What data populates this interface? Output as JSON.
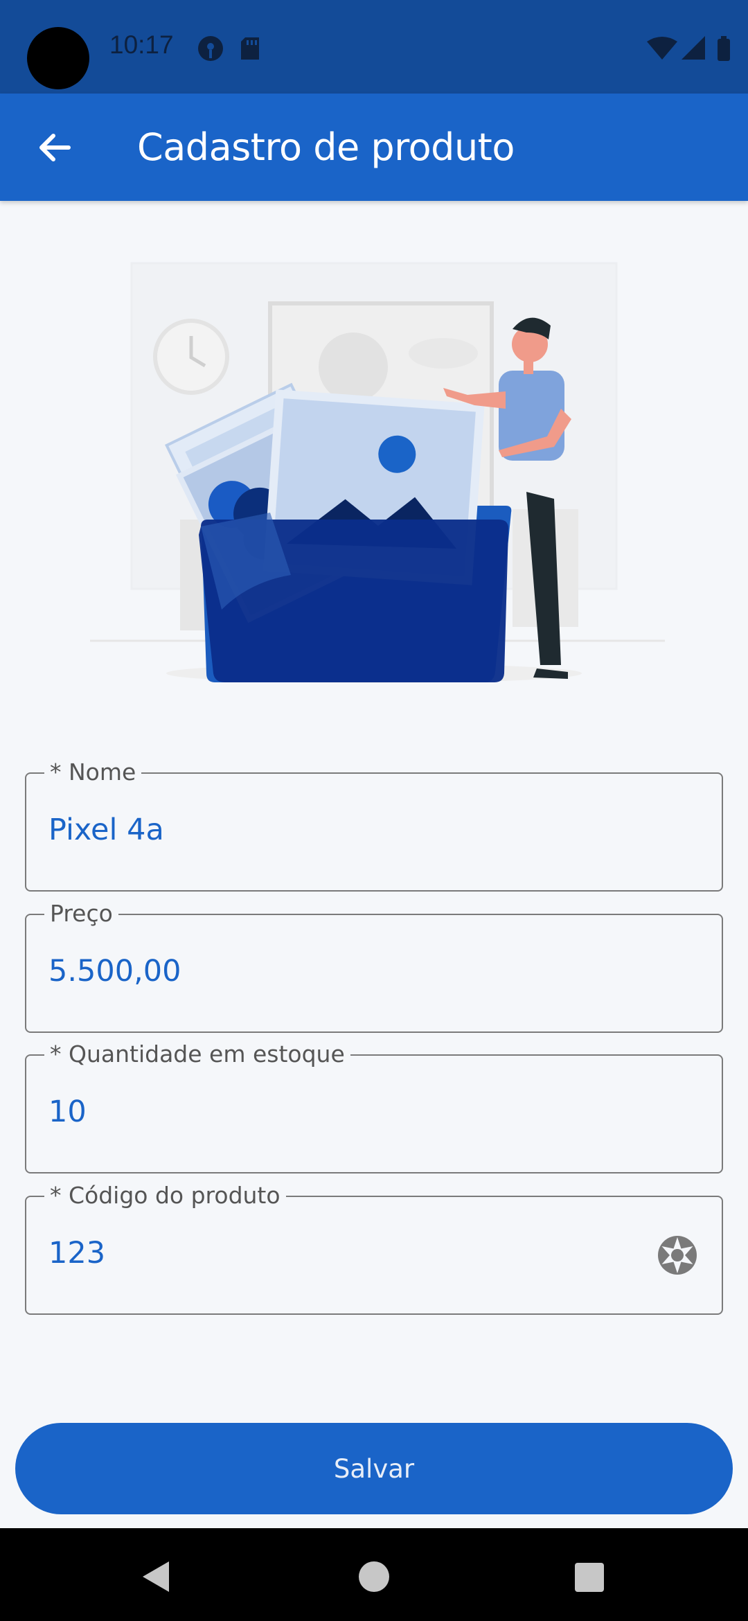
{
  "status_bar": {
    "time": "10:17",
    "left_icons": [
      "podcast-icon",
      "sd-card-icon"
    ],
    "right_icons": [
      "wifi-icon",
      "signal-icon",
      "battery-icon"
    ]
  },
  "app_bar": {
    "title": "Cadastro de produto",
    "back_icon": "arrow-back-icon"
  },
  "form": {
    "fields": [
      {
        "label": "* Nome",
        "value": "Pixel 4a"
      },
      {
        "label": "Preço",
        "value": "5.500,00"
      },
      {
        "label": "* Quantidade em estoque",
        "value": "10"
      },
      {
        "label": "* Código do produto",
        "value": "123",
        "trailing_icon": "camera-shutter-icon"
      }
    ],
    "save_label": "Salvar"
  },
  "nav_bar": {
    "buttons": [
      "back-triangle-icon",
      "home-circle-icon",
      "recents-square-icon"
    ]
  },
  "colors": {
    "status_bar": "#134b98",
    "app_bar": "#1a64c8",
    "accent": "#1a64c8",
    "background": "#f5f7fa"
  }
}
